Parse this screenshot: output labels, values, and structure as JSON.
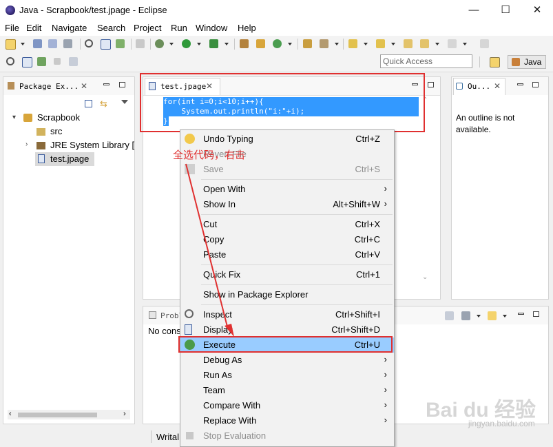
{
  "window": {
    "title": "Java - Scrapbook/test.jpage - Eclipse",
    "minimize": "—",
    "maximize": "☐",
    "close": "✕"
  },
  "menu": [
    "File",
    "Edit",
    "Navigate",
    "Search",
    "Project",
    "Run",
    "Window",
    "Help"
  ],
  "quick_access": {
    "placeholder": "Quick Access"
  },
  "perspective": {
    "label": "Java"
  },
  "package_explorer": {
    "tab_label": "Package Ex...",
    "tree": [
      {
        "label": "Scrapbook",
        "icon": "project-icon"
      },
      {
        "label": "src",
        "icon": "source-folder-icon"
      },
      {
        "label": "JRE System Library [",
        "icon": "library-icon"
      },
      {
        "label": "test.jpage",
        "icon": "scrapbook-file-icon"
      }
    ]
  },
  "editor": {
    "tab_label": "test.jpage",
    "code_lines": [
      "for(int i=0;i<10;i++){",
      "    System.out.println(\"i:\"+i);",
      "}"
    ]
  },
  "outline": {
    "tab_label": "Ou...",
    "message": "An outline is not available."
  },
  "problems": {
    "tab_label": "Probl",
    "content": "No cons"
  },
  "status_bar": {
    "writable": "Writal"
  },
  "annotation": {
    "text": "全选代码，右击",
    "color": "#e03030"
  },
  "context_menu": {
    "items": [
      {
        "label": "Undo Typing",
        "shortcut": "Ctrl+Z",
        "icon": "undo-icon",
        "enabled": true
      },
      {
        "label": "Revert File",
        "shortcut": "",
        "enabled": false
      },
      {
        "label": "Save",
        "shortcut": "Ctrl+S",
        "icon": "save-icon",
        "enabled": false
      },
      {
        "label": "Open With",
        "submenu": true
      },
      {
        "label": "Show In",
        "shortcut": "Alt+Shift+W",
        "submenu": true
      },
      {
        "label": "Cut",
        "shortcut": "Ctrl+X"
      },
      {
        "label": "Copy",
        "shortcut": "Ctrl+C"
      },
      {
        "label": "Paste",
        "shortcut": "Ctrl+V"
      },
      {
        "label": "Quick Fix",
        "shortcut": "Ctrl+1"
      },
      {
        "label": "Show in Package Explorer",
        "shortcut": ""
      },
      {
        "label": "Inspect",
        "shortcut": "Ctrl+Shift+I",
        "icon": "inspect-icon"
      },
      {
        "label": "Display",
        "shortcut": "Ctrl+Shift+D",
        "icon": "display-icon"
      },
      {
        "label": "Execute",
        "shortcut": "Ctrl+U",
        "icon": "execute-icon",
        "highlighted": true
      },
      {
        "label": "Debug As",
        "submenu": true
      },
      {
        "label": "Run As",
        "submenu": true
      },
      {
        "label": "Team",
        "submenu": true
      },
      {
        "label": "Compare With",
        "submenu": true
      },
      {
        "label": "Replace With",
        "submenu": true
      },
      {
        "label": "Stop Evaluation",
        "icon": "stop-icon",
        "enabled": false
      }
    ]
  },
  "watermark": {
    "text": "Bai du 经验",
    "sub": "jingyan.baidu.com"
  },
  "colors": {
    "selection": "#3399ff",
    "menu_highlight": "#99ccff",
    "red_box": "#e03030"
  }
}
